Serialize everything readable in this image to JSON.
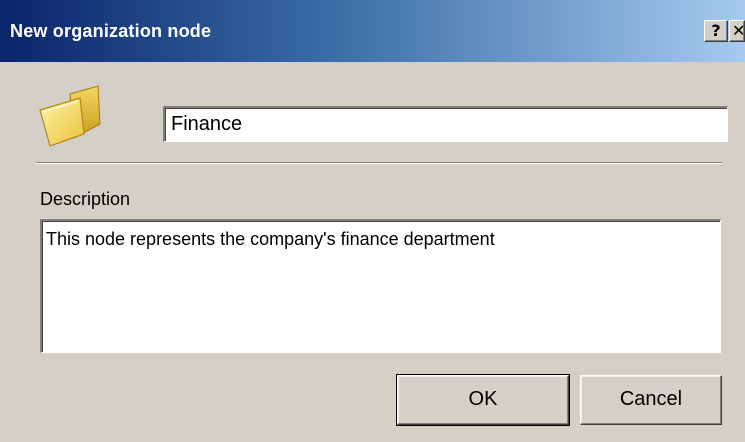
{
  "window": {
    "title": "New organization node",
    "help_button": "?",
    "close_button": "✕"
  },
  "name_field": {
    "value": "Finance"
  },
  "description": {
    "label": "Description",
    "value": "This node represents the company's finance department"
  },
  "buttons": {
    "ok": "OK",
    "cancel": "Cancel"
  },
  "icons": {
    "folder": "folder-icon"
  },
  "colors": {
    "titlebar_start": "#0a246a",
    "titlebar_end": "#a6caf0",
    "dialog_bg": "#d4d0c8"
  }
}
